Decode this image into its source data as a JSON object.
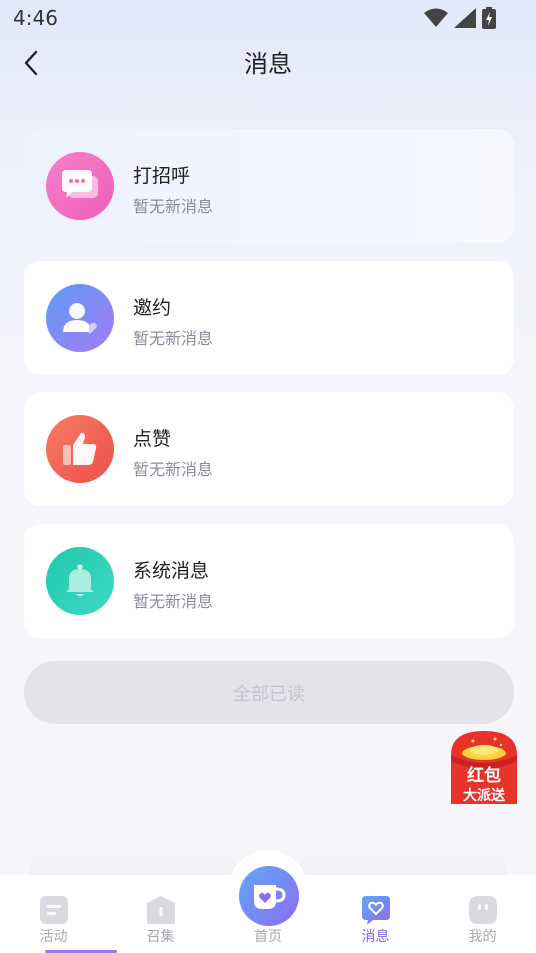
{
  "status_bar": {
    "time": "4:46",
    "icons": [
      "wifi-icon",
      "cell-signal-icon",
      "battery-charging-icon"
    ]
  },
  "header": {
    "title": "消息",
    "back_icon": "chevron-left-icon"
  },
  "messages": [
    {
      "title": "打招呼",
      "subtitle": "暂无新消息",
      "icon": "chat-bubble-icon",
      "color": "#f06fc4"
    },
    {
      "title": "邀约",
      "subtitle": "暂无新消息",
      "icon": "user-heart-icon",
      "color": "#7a84f6"
    },
    {
      "title": "点赞",
      "subtitle": "暂无新消息",
      "icon": "thumbs-up-icon",
      "color": "#f36656"
    },
    {
      "title": "系统消息",
      "subtitle": "暂无新消息",
      "icon": "bell-icon",
      "color": "#21c9b0"
    }
  ],
  "mark_all_read": "全部已读",
  "red_packet": {
    "line1": "红包",
    "line2": "大派送"
  },
  "tabbar": {
    "tabs": [
      {
        "label": "活动",
        "icon": "activity-icon"
      },
      {
        "label": "召集",
        "icon": "gather-icon"
      },
      {
        "label": "首页",
        "icon": "cup-heart-icon"
      },
      {
        "label": "消息",
        "icon": "message-heart-icon",
        "active": true
      },
      {
        "label": "我的",
        "icon": "profile-face-icon"
      }
    ]
  },
  "colors": {
    "accent": "#7b6bf0",
    "inactive": "#a8a8b0"
  }
}
